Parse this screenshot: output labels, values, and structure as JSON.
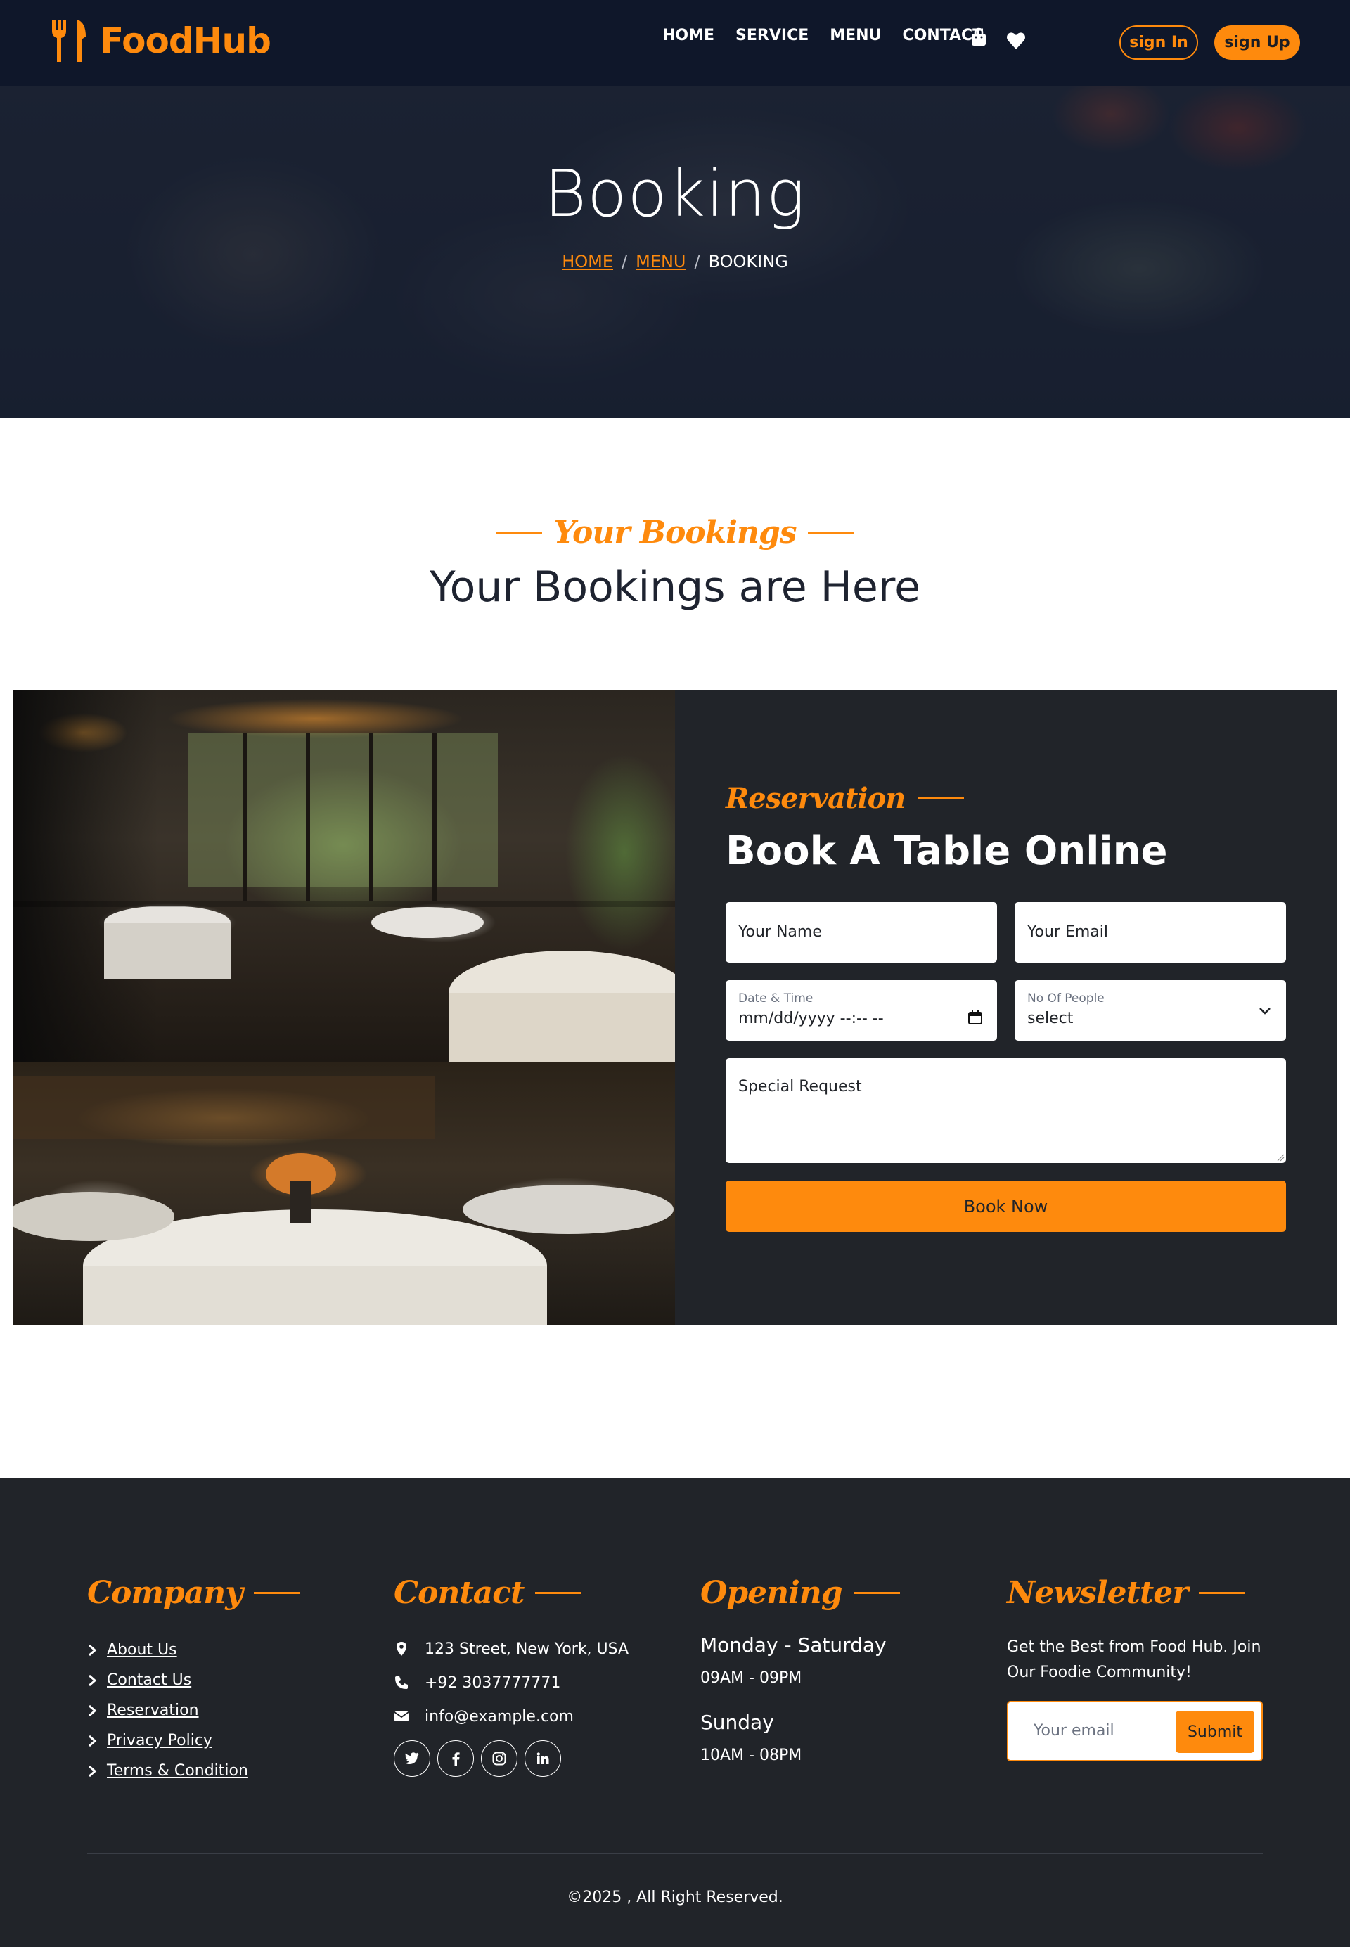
{
  "brand": {
    "name": "FoodHub",
    "accent_color": "#fe8a0d",
    "dark_color": "#0f172a",
    "panel_color": "#212429"
  },
  "nav": {
    "links": [
      "HOME",
      "SERVICE",
      "MENU",
      "CONTACT"
    ],
    "icons": [
      "shopping-bag-icon",
      "heart-icon"
    ],
    "signin_label": "sign In",
    "signup_label": "sign Up"
  },
  "hero": {
    "title": "Booking",
    "breadcrumb": {
      "home": "HOME",
      "menu": "MENU",
      "current": "BOOKING",
      "separator": "/"
    }
  },
  "bookings_section": {
    "subtitle": "Your Bookings",
    "title": "Your Bookings are Here"
  },
  "reservation": {
    "subtitle": "Reservation",
    "title": "Book A Table Online",
    "name_placeholder": "Your Name",
    "email_placeholder": "Your Email",
    "date_label": "Date & Time",
    "date_value": "mm/dd/yyyy --:-- --",
    "people_label": "No Of People",
    "people_value": "select",
    "request_placeholder": "Special Request",
    "submit_label": "Book Now"
  },
  "footer": {
    "company": {
      "title": "Company",
      "links": [
        "About Us",
        "Contact Us",
        "Reservation",
        "Privacy Policy",
        "Terms & Condition"
      ]
    },
    "contact": {
      "title": "Contact",
      "address": "123 Street, New York, USA",
      "phone": "+92 3037777771",
      "email": "info@example.com",
      "socials": [
        "twitter-icon",
        "facebook-icon",
        "instagram-icon",
        "linkedin-icon"
      ]
    },
    "opening": {
      "title": "Opening",
      "days1": "Monday - Saturday",
      "hours1": "09AM - 09PM",
      "days2": "Sunday",
      "hours2": "10AM - 08PM"
    },
    "newsletter": {
      "title": "Newsletter",
      "text": "Get the Best from Food Hub. Join Our Foodie Community!",
      "input_placeholder": "Your email",
      "submit_label": "Submit"
    },
    "copyright": "©2025 , All Right Reserved."
  }
}
